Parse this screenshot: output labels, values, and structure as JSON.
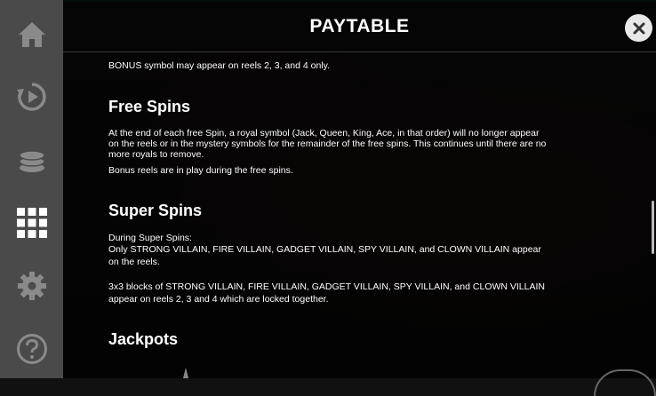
{
  "header": {
    "title": "PAYTABLE"
  },
  "sidebar": {
    "items": [
      {
        "icon": "home-icon"
      },
      {
        "icon": "autoplay-icon"
      },
      {
        "icon": "coins-icon"
      },
      {
        "icon": "paytable-grid-icon"
      },
      {
        "icon": "gear-icon"
      },
      {
        "icon": "help-icon"
      }
    ]
  },
  "close": {
    "icon": "close-icon",
    "symbol": "✕"
  },
  "content": {
    "bonus_note": "BONUS symbol may appear on reels 2, 3, and 4 only.",
    "free_spins": {
      "heading": "Free Spins",
      "line1": "At the end of each free Spin, a royal symbol (Jack, Queen, King, Ace, in that order) will no longer appear",
      "line2": "on the reels or in the mystery symbols for the remainder of the free spins. This continues until there are no",
      "line3": "more royals to remove.",
      "line4": "Bonus reels are in play during the free spins."
    },
    "super_spins": {
      "heading": "Super Spins",
      "line1": "During Super Spins:",
      "line2": "Only STRONG VILLAIN, FIRE VILLAIN, GADGET VILLAIN, SPY VILLAIN, and CLOWN VILLAIN appear",
      "line3": "on the reels.",
      "line4": "3x3 blocks of STRONG VILLAIN, FIRE VILLAIN, GADGET VILLAIN, SPY VILLAIN, and CLOWN VILLAIN",
      "line5": "appear on reels 2, 3 and 4 which are locked together."
    },
    "jackpots": {
      "heading": "Jackpots"
    }
  }
}
